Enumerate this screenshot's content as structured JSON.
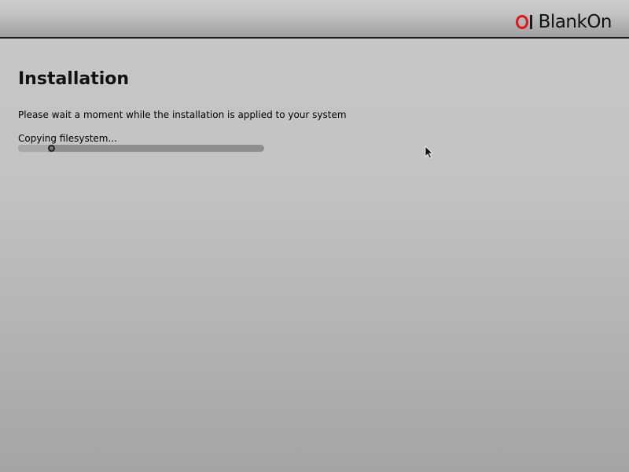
{
  "header": {
    "logo_text": "BlankOn"
  },
  "main": {
    "title": "Installation",
    "subtitle": "Please wait a moment while the installation is applied to your system",
    "status": "Copying filesystem...",
    "progress_fraction": 0.13
  },
  "icons": [
    "blankon-logo-icon",
    "spinner-icon",
    "mouse-pointer-icon"
  ],
  "colors": {
    "accent": "#e0141b",
    "header_border": "#1a1a1a"
  }
}
